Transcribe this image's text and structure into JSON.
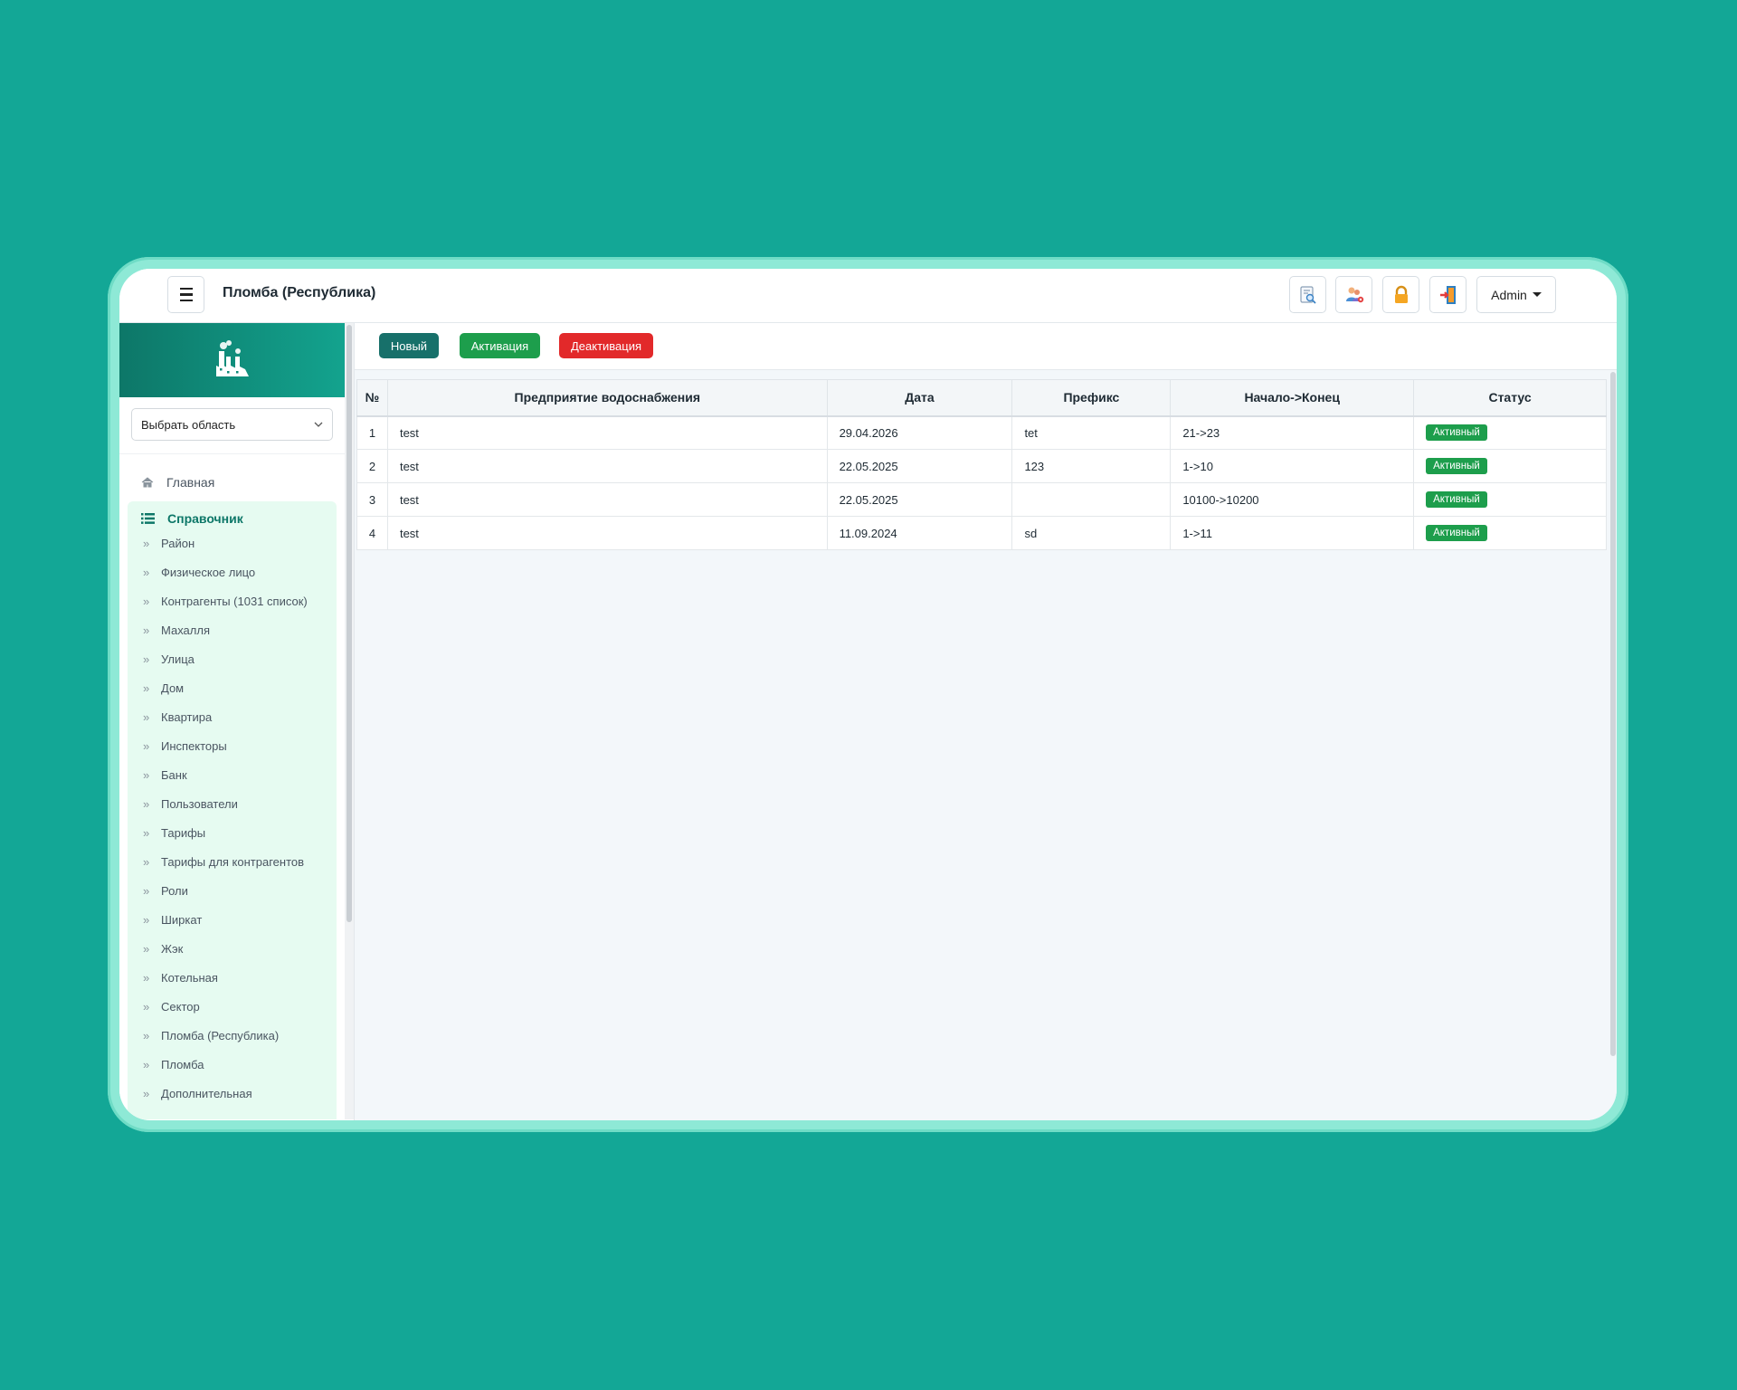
{
  "header": {
    "title": "Пломба (Республика)",
    "user_label": "Admin",
    "icons": [
      "report-search-icon",
      "users-settings-icon",
      "lock-icon",
      "logout-door-icon"
    ]
  },
  "sidebar": {
    "region_select": {
      "selected": "Выбрать область"
    },
    "home_label": "Главная",
    "group_label": "Справочник",
    "items": [
      {
        "label": "Район"
      },
      {
        "label": "Физическое лицо"
      },
      {
        "label": "Контрагенты (1031 список)"
      },
      {
        "label": "Махалля"
      },
      {
        "label": "Улица"
      },
      {
        "label": "Дом"
      },
      {
        "label": "Квартира"
      },
      {
        "label": "Инспекторы"
      },
      {
        "label": "Банк"
      },
      {
        "label": "Пользователи"
      },
      {
        "label": "Тарифы"
      },
      {
        "label": "Тарифы для контрагентов"
      },
      {
        "label": "Роли"
      },
      {
        "label": "Ширкат"
      },
      {
        "label": "Жэк"
      },
      {
        "label": "Котельная"
      },
      {
        "label": "Сектор"
      },
      {
        "label": "Пломба (Республика)"
      },
      {
        "label": "Пломба"
      },
      {
        "label": "Дополнительная"
      }
    ]
  },
  "toolbar": {
    "new_label": "Новый",
    "activate_label": "Активация",
    "deactivate_label": "Деактивация"
  },
  "table": {
    "columns": [
      "№",
      "Предприятие водоснабжения",
      "Дата",
      "Префикс",
      "Начало->Конец",
      "Статус"
    ],
    "rows": [
      {
        "num": "1",
        "enterprise": "test",
        "date": "29.04.2026",
        "prefix": "tet",
        "range": "21->23",
        "status": "Активный"
      },
      {
        "num": "2",
        "enterprise": "test",
        "date": "22.05.2025",
        "prefix": "123",
        "range": "1->10",
        "status": "Активный"
      },
      {
        "num": "3",
        "enterprise": "test",
        "date": "22.05.2025",
        "prefix": "",
        "range": "10100->10200",
        "status": "Активный"
      },
      {
        "num": "4",
        "enterprise": "test",
        "date": "11.09.2024",
        "prefix": "sd",
        "range": "1->11",
        "status": "Активный"
      }
    ]
  },
  "colors": {
    "background": "#13a796",
    "brand_dark": "#0d7768",
    "new_button": "#17706a",
    "activate_button": "#1d9e4c",
    "deactivate_button": "#e2292a",
    "status_badge": "#1d9e4c",
    "sidebar_group_bg": "#e6fbf1"
  }
}
